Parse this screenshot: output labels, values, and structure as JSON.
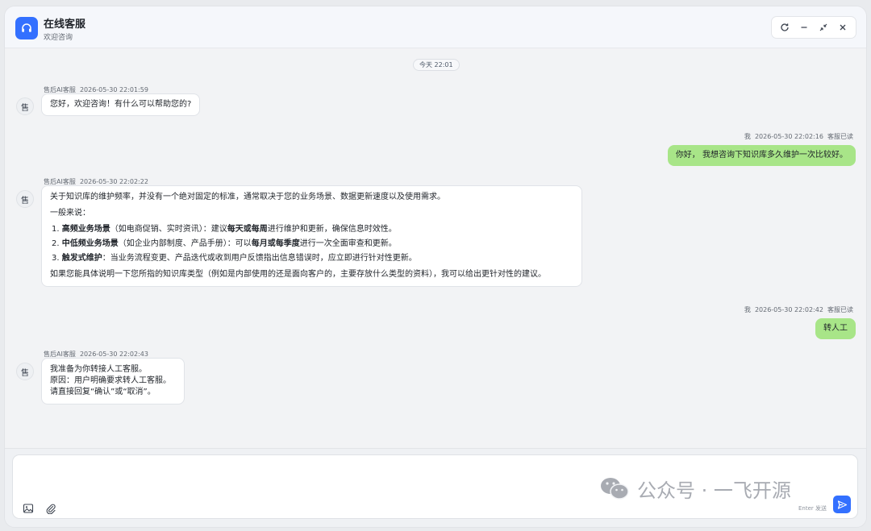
{
  "header": {
    "title": "在线客服",
    "subtitle": "欢迎咨询"
  },
  "time_divider": "今天 22:01",
  "messages": [
    {
      "sender": "售后AI客服",
      "time": "2026-05-30 22:01:59",
      "avatar": "售",
      "text": "您好，欢迎咨询！有什么可以帮助您的?"
    },
    {
      "sender": "我",
      "time": "2026-05-30 22:02:16",
      "read": "客服已读",
      "text": "你好， 我想咨询下知识库多久维护一次比较好。"
    },
    {
      "sender": "售后AI客服",
      "time": "2026-05-30 22:02:22",
      "avatar": "售",
      "intro": "关于知识库的维护频率，并没有一个绝对固定的标准，通常取决于您的业务场景、数据更新速度以及使用需求。",
      "lead": "一般来说：",
      "items": [
        {
          "num": "1.",
          "bold": "高频业务场景",
          "a": "（如电商促销、实时资讯）：建议",
          "bold2": "每天或每周",
          "b": "进行维护和更新，确保信息时效性。"
        },
        {
          "num": "2.",
          "bold": "中低频业务场景",
          "a": "（如企业内部制度、产品手册）：可以",
          "bold2": "每月或每季度",
          "b": "进行一次全面审查和更新。"
        },
        {
          "num": "3.",
          "bold": "触发式维护",
          "a": "：当业务流程变更、产品迭代或收到用户反馈指出信息错误时，应立即进行针对性更新。",
          "bold2": "",
          "b": ""
        }
      ],
      "outro": "如果您能具体说明一下您所指的知识库类型（例如是内部使用的还是面向客户的，主要存放什么类型的资料），我可以给出更针对性的建议。"
    },
    {
      "sender": "我",
      "time": "2026-05-30 22:02:42",
      "read": "客服已读",
      "text": "转人工"
    },
    {
      "sender": "售后AI客服",
      "time": "2026-05-30 22:02:43",
      "avatar": "售",
      "lines": [
        "我准备为你转接人工客服。",
        "原因：用户明确要求转人工客服。",
        "请直接回复“确认”或“取消”。"
      ]
    }
  ],
  "input": {
    "placeholder": "",
    "hint": "Enter 发送"
  },
  "watermark": {
    "text": "公众号 · 一飞开源"
  },
  "colors": {
    "accent": "#3370ff",
    "outgoing_bubble": "#a8e588"
  }
}
